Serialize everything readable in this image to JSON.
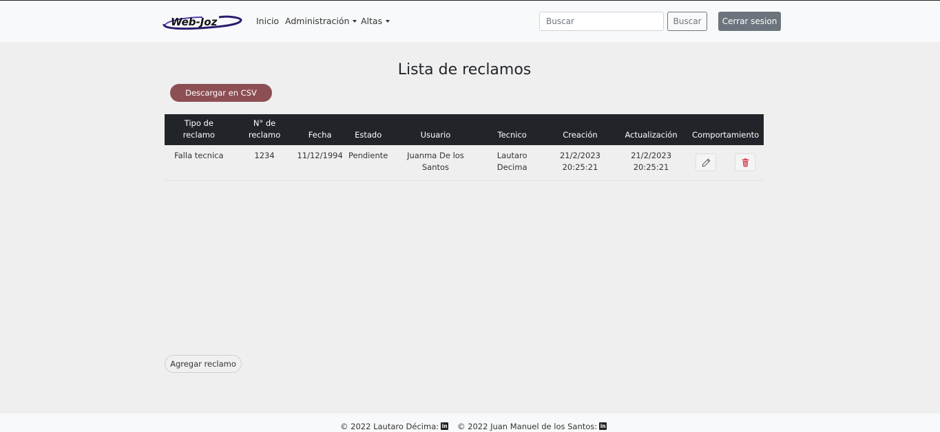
{
  "navbar": {
    "logo_text": "Web-Joz",
    "links": [
      {
        "label": "Inicio"
      },
      {
        "label": "Administración"
      },
      {
        "label": "Altas"
      }
    ],
    "search_placeholder": "Buscar",
    "search_button": "Buscar",
    "logout_button": "Cerrar sesion"
  },
  "main": {
    "title": "Lista de reclamos",
    "csv_button": "Descargar en CSV",
    "add_button": "Agregar reclamo"
  },
  "table": {
    "headers": {
      "tipo_l1": "Tipo de",
      "tipo_l2": "reclamo",
      "num_l1": "N° de",
      "num_l2": "reclamo",
      "fecha": "Fecha",
      "estado": "Estado",
      "usuario": "Usuario",
      "tecnico": "Tecnico",
      "creacion": "Creación",
      "actualizacion": "Actualización",
      "comportamiento": "Comportamiento"
    },
    "rows": [
      {
        "tipo": "Falla tecnica",
        "numero": "1234",
        "fecha": "11/12/1994",
        "estado": "Pendiente",
        "usuario_l1": "Juanma De los",
        "usuario_l2": "Santos",
        "tecnico_l1": "Lautaro",
        "tecnico_l2": "Decima",
        "creacion_date": "21/2/2023",
        "creacion_time": "20:25:21",
        "actualizacion_date": "21/2/2023",
        "actualizacion_time": "20:25:21"
      }
    ]
  },
  "icons": {
    "edit": "pencil-icon",
    "delete": "trash-icon",
    "linkedin": "linkedin-icon"
  },
  "colors": {
    "csv_button": "#8c4f54",
    "delete_icon": "#dc3545",
    "table_header": "#212529"
  },
  "footer": {
    "credit_1": "© 2022 Lautaro Décima:",
    "credit_2": "© 2022 Juan Manuel de los Santos:",
    "linkedin_glyph": "in"
  }
}
